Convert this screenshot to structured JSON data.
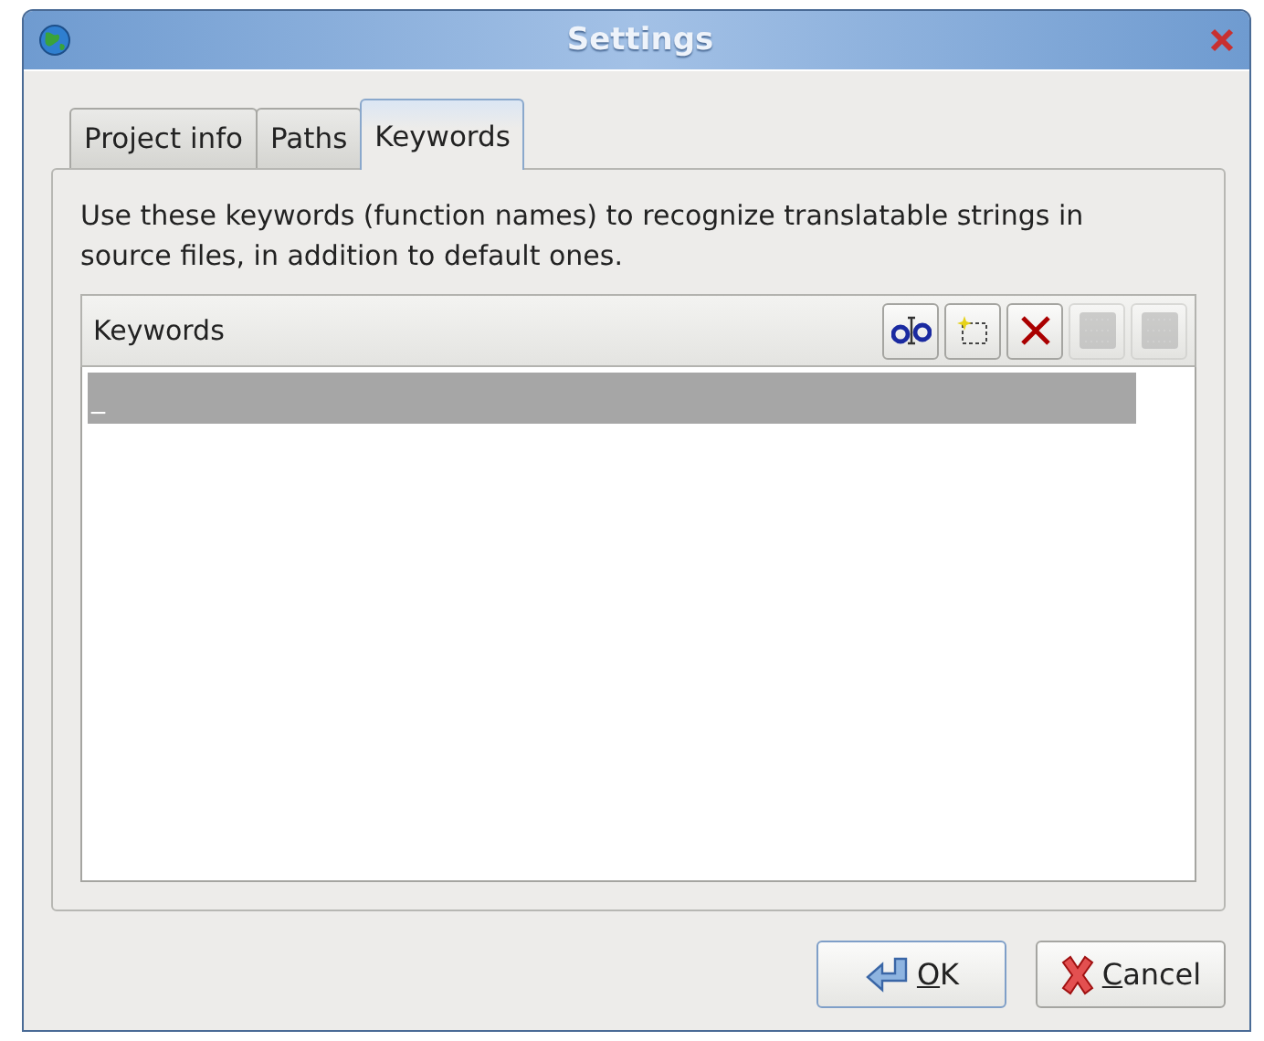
{
  "window": {
    "title": "Settings"
  },
  "tabs": [
    {
      "label": "Project info",
      "selected": false
    },
    {
      "label": "Paths",
      "selected": false
    },
    {
      "label": "Keywords",
      "selected": true
    }
  ],
  "description": "Use these keywords (function names) to recognize translatable strings in source files, in addition to default ones.",
  "keywords": {
    "header": "Keywords",
    "tools": [
      {
        "kind": "rename",
        "disabled": false
      },
      {
        "kind": "new",
        "disabled": false
      },
      {
        "kind": "delete",
        "disabled": false
      },
      {
        "kind": "up",
        "disabled": true
      },
      {
        "kind": "down",
        "disabled": true
      }
    ],
    "items": [
      {
        "text": "_",
        "selected": true
      }
    ]
  },
  "buttons": [
    {
      "kind": "ok",
      "label": "OK",
      "mnemonic_underlined": true
    },
    {
      "kind": "cancel",
      "label": "Cancel",
      "mnemonic_underlined": true
    }
  ]
}
